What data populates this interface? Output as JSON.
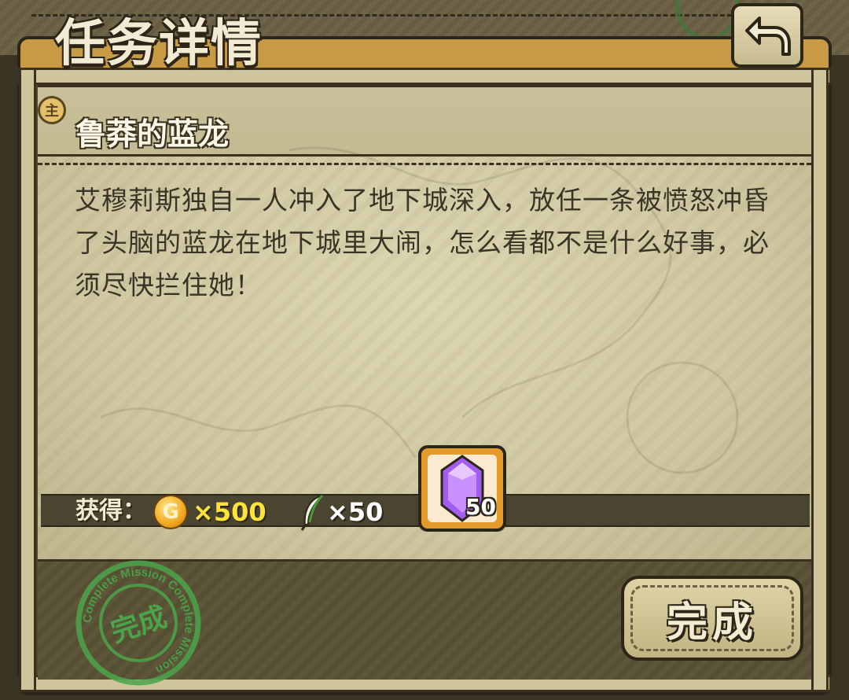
{
  "header": {
    "title": "任务详情"
  },
  "quest": {
    "type_badge": "主",
    "name": "鲁莽的蓝龙",
    "description": "艾穆莉斯独自一人冲入了地下城深入，放任一条被愤怒冲昏了头脑的蓝龙在地下城里大闹，怎么看都不是什么好事，必须尽快拦住她！"
  },
  "rewards": {
    "label": "获得：",
    "gold": {
      "icon": "gold-coin-icon",
      "coin_letter": "G",
      "amount": "×500"
    },
    "feather": {
      "icon": "feather-icon",
      "amount": "×50"
    },
    "gem": {
      "icon": "purple-gem-icon",
      "count": "50"
    }
  },
  "stamp": {
    "center_text": "完成",
    "ring_text": "Complete Mission Complete Mission"
  },
  "actions": {
    "complete_label": "完成"
  },
  "colors": {
    "frame_orange": "#c89a44",
    "paper": "#d6cfa9",
    "gold_text": "#ffe23a",
    "stamp_green": "#4aa44a",
    "gem_purple": "#a25cf0"
  }
}
